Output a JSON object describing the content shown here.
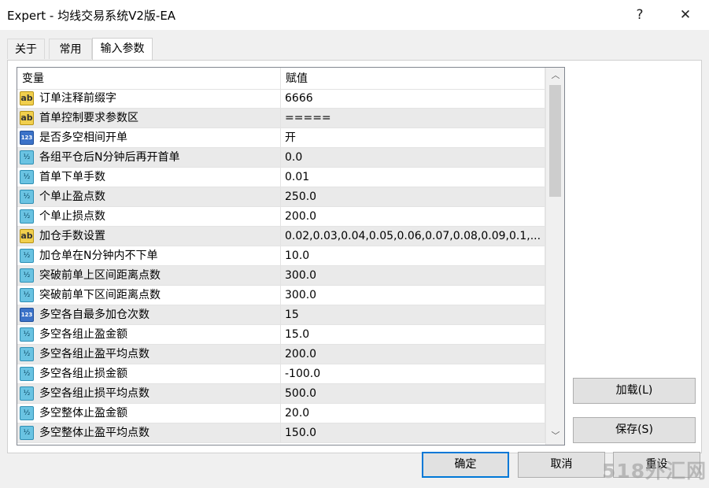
{
  "window": {
    "title": "Expert - 均线交易系统V2版-EA",
    "help_glyph": "?",
    "close_glyph": "✕"
  },
  "tabs": [
    {
      "label": "关于",
      "active": false
    },
    {
      "label": "常用",
      "active": false
    },
    {
      "label": "输入参数",
      "active": true
    }
  ],
  "grid": {
    "col_variable": "变量",
    "col_value": "赋值",
    "rows": [
      {
        "icon": "ab",
        "name": "订单注释前缀字",
        "value": "6666"
      },
      {
        "icon": "ab",
        "name": "首单控制要求参数区",
        "value": "====="
      },
      {
        "icon": "123",
        "name": "是否多空相间开单",
        "value": "开"
      },
      {
        "icon": "half",
        "name": "各组平仓后N分钟后再开首单",
        "value": "0.0"
      },
      {
        "icon": "half",
        "name": "首单下单手数",
        "value": "0.01"
      },
      {
        "icon": "half",
        "name": "个单止盈点数",
        "value": "250.0"
      },
      {
        "icon": "half",
        "name": "个单止损点数",
        "value": "200.0"
      },
      {
        "icon": "ab",
        "name": "加仓手数设置",
        "value": "0.02,0.03,0.04,0.05,0.06,0.07,0.08,0.09,0.1,..."
      },
      {
        "icon": "half",
        "name": "加仓单在N分钟内不下单",
        "value": "10.0"
      },
      {
        "icon": "half",
        "name": "突破前单上区间距离点数",
        "value": "300.0"
      },
      {
        "icon": "half",
        "name": "突破前单下区间距离点数",
        "value": "300.0"
      },
      {
        "icon": "123",
        "name": "多空各自最多加仓次数",
        "value": "15"
      },
      {
        "icon": "half",
        "name": "多空各组止盈金额",
        "value": "15.0"
      },
      {
        "icon": "half",
        "name": "多空各组止盈平均点数",
        "value": "200.0"
      },
      {
        "icon": "half",
        "name": "多空各组止损金额",
        "value": "-100.0"
      },
      {
        "icon": "half",
        "name": "多空各组止损平均点数",
        "value": "500.0"
      },
      {
        "icon": "half",
        "name": "多空整体止盈金额",
        "value": "20.0"
      },
      {
        "icon": "half",
        "name": "多空整体止盈平均点数",
        "value": "150.0"
      }
    ]
  },
  "icon_glyphs": {
    "ab": "ab",
    "123": "123",
    "half": "½"
  },
  "scrollbar": {
    "up_glyph": "︿",
    "down_glyph": "﹀"
  },
  "buttons": {
    "load": "加载(L)",
    "save": "保存(S)",
    "ok": "确定",
    "cancel": "取消",
    "reset": "重设"
  },
  "watermark": "518外汇网"
}
